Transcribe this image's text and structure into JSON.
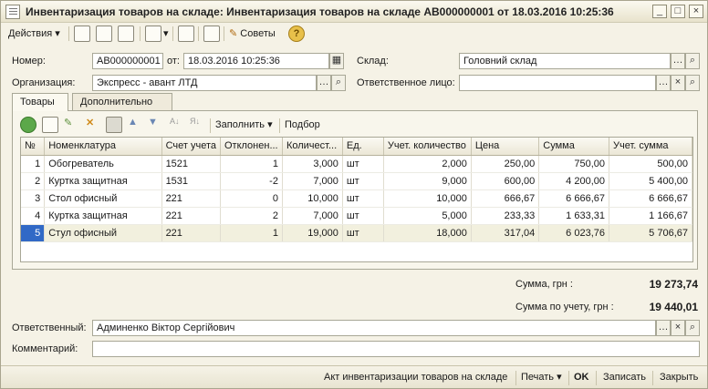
{
  "window": {
    "title": "Инвентаризация товаров на складе: Инвентаризация товаров на складе АВ000000001 от 18.03.2016 10:25:36",
    "buttons": [
      "_",
      "□",
      "×"
    ]
  },
  "toolbar": {
    "actions_label": "Действия",
    "advice_label": "Советы",
    "help_label": "?"
  },
  "form": {
    "number_label": "Номер:",
    "number_value": "АВ000000001",
    "from_label": "от:",
    "date_value": "18.03.2016 10:25:36",
    "warehouse_label": "Склад:",
    "warehouse_value": "Головний склад",
    "org_label": "Организация:",
    "org_value": "Экспресс - авант ЛТД",
    "resp_person_label": "Ответственное лицо:",
    "resp_person_value": ""
  },
  "tabs": [
    {
      "label": "Товары",
      "active": true
    },
    {
      "label": "Дополнительно",
      "active": false
    }
  ],
  "table_toolbar": {
    "fill_label": "Заполнить",
    "select_label": "Подбор"
  },
  "table": {
    "columns": [
      "№",
      "Номенклатура",
      "Счет учета",
      "Отклонен...",
      "Количест...",
      "Ед.",
      "Учет. количество",
      "Цена",
      "Сумма",
      "Учет. сумма"
    ],
    "rows": [
      [
        "1",
        "Обогреватель",
        "1521",
        "1",
        "3,000",
        "шт",
        "2,000",
        "250,00",
        "750,00",
        "500,00"
      ],
      [
        "2",
        "Куртка защитная",
        "1531",
        "-2",
        "7,000",
        "шт",
        "9,000",
        "600,00",
        "4 200,00",
        "5 400,00"
      ],
      [
        "3",
        "Стол офисный",
        "221",
        "0",
        "10,000",
        "шт",
        "10,000",
        "666,67",
        "6 666,67",
        "6 666,67"
      ],
      [
        "4",
        "Куртка защитная",
        "221",
        "2",
        "7,000",
        "шт",
        "5,000",
        "233,33",
        "1 633,31",
        "1 166,67"
      ],
      [
        "5",
        "Стул офисный",
        "221",
        "1",
        "19,000",
        "шт",
        "18,000",
        "317,04",
        "6 023,76",
        "5 706,67"
      ]
    ],
    "selected_row": 4
  },
  "totals": {
    "sum_label": "Сумма, грн :",
    "sum_value": "19 273,74",
    "acc_sum_label": "Сумма по учету, грн :",
    "acc_sum_value": "19 440,01"
  },
  "bottom": {
    "responsible_label": "Ответственный:",
    "responsible_value": "Админенко Віктор Сергійович",
    "comment_label": "Комментарий:",
    "comment_value": ""
  },
  "footer": {
    "act_label": "Акт инвентаризации товаров на складе",
    "print_label": "Печать",
    "ok_label": "OK",
    "save_label": "Записать",
    "close_label": "Закрыть"
  }
}
